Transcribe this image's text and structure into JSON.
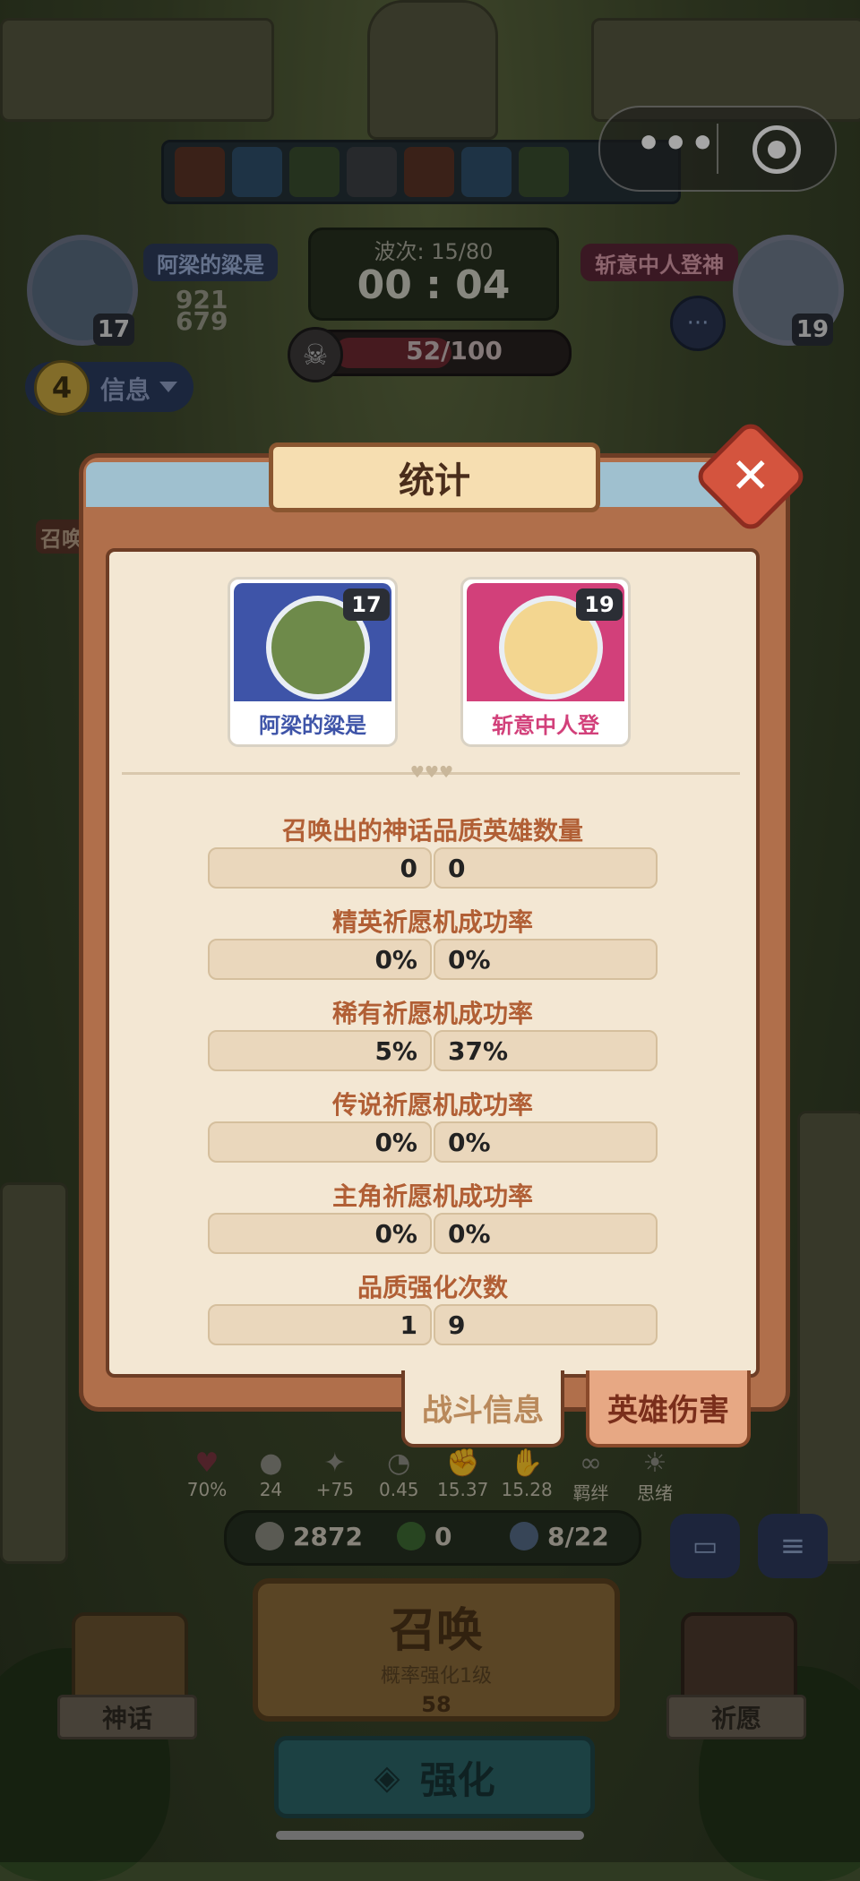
{
  "hud": {
    "wave_label": "波次: 15/80",
    "timer": "00 : 04",
    "boss_progress_text": "52/100",
    "boss_progress": 0.52,
    "player_left": {
      "name": "阿梁的粱是",
      "level": "17",
      "score_top": "921",
      "score_bottom": "679"
    },
    "player_right": {
      "name": "斩意中人登神",
      "level": "19"
    },
    "info_button": "信息",
    "info_count": "4",
    "summon_side_label": "召唤"
  },
  "modal": {
    "title": "统计",
    "players": [
      {
        "name": "阿梁的粱是",
        "level": "17",
        "color": "#3e54a8"
      },
      {
        "name": "斩意中人登",
        "level": "19",
        "color": "#d2407a"
      }
    ],
    "stats": [
      {
        "label": "召唤出的神话品质英雄数量",
        "left": "0",
        "right": "0"
      },
      {
        "label": "精英祈愿机成功率",
        "left": "0%",
        "right": "0%"
      },
      {
        "label": "稀有祈愿机成功率",
        "left": "5%",
        "right": "37%"
      },
      {
        "label": "传说祈愿机成功率",
        "left": "0%",
        "right": "0%"
      },
      {
        "label": "主角祈愿机成功率",
        "left": "0%",
        "right": "0%"
      },
      {
        "label": "品质强化次数",
        "left": "1",
        "right": "9"
      }
    ],
    "tabs": {
      "active": "战斗信息",
      "inactive": "英雄伤害"
    }
  },
  "bottom": {
    "stats": [
      "70%",
      "24",
      "+75",
      "0.45",
      "15.37",
      "15.28",
      "羁绊",
      "思绪"
    ],
    "coins": "2872",
    "clover": "0",
    "units": "8/22",
    "summon_title": "召唤",
    "summon_sub": "概率强化1级",
    "summon_cost": "58",
    "upgrade": "强化",
    "left_label": "神话",
    "right_label": "祈愿"
  },
  "colors": {
    "accent": "#b15f35",
    "modal_wood": "#b06f4b",
    "close": "#d4543e"
  },
  "icons": [
    "more-dots-icon",
    "target-icon",
    "close-icon",
    "skull-icon",
    "chat-icon",
    "menu-icon"
  ]
}
